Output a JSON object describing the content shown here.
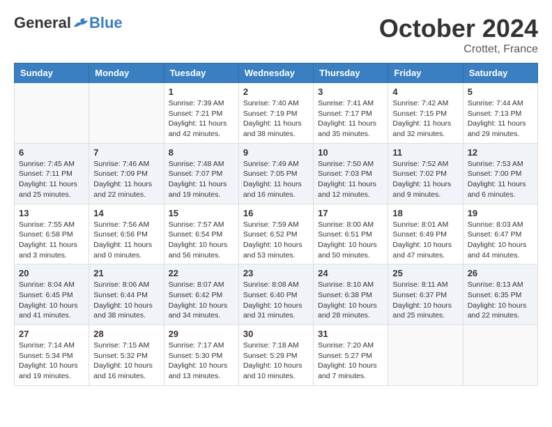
{
  "header": {
    "logo_general": "General",
    "logo_blue": "Blue",
    "month": "October 2024",
    "location": "Crottet, France"
  },
  "weekdays": [
    "Sunday",
    "Monday",
    "Tuesday",
    "Wednesday",
    "Thursday",
    "Friday",
    "Saturday"
  ],
  "weeks": [
    [
      {
        "day": "",
        "sunrise": "",
        "sunset": "",
        "daylight": ""
      },
      {
        "day": "",
        "sunrise": "",
        "sunset": "",
        "daylight": ""
      },
      {
        "day": "1",
        "sunrise": "Sunrise: 7:39 AM",
        "sunset": "Sunset: 7:21 PM",
        "daylight": "Daylight: 11 hours and 42 minutes."
      },
      {
        "day": "2",
        "sunrise": "Sunrise: 7:40 AM",
        "sunset": "Sunset: 7:19 PM",
        "daylight": "Daylight: 11 hours and 38 minutes."
      },
      {
        "day": "3",
        "sunrise": "Sunrise: 7:41 AM",
        "sunset": "Sunset: 7:17 PM",
        "daylight": "Daylight: 11 hours and 35 minutes."
      },
      {
        "day": "4",
        "sunrise": "Sunrise: 7:42 AM",
        "sunset": "Sunset: 7:15 PM",
        "daylight": "Daylight: 11 hours and 32 minutes."
      },
      {
        "day": "5",
        "sunrise": "Sunrise: 7:44 AM",
        "sunset": "Sunset: 7:13 PM",
        "daylight": "Daylight: 11 hours and 29 minutes."
      }
    ],
    [
      {
        "day": "6",
        "sunrise": "Sunrise: 7:45 AM",
        "sunset": "Sunset: 7:11 PM",
        "daylight": "Daylight: 11 hours and 25 minutes."
      },
      {
        "day": "7",
        "sunrise": "Sunrise: 7:46 AM",
        "sunset": "Sunset: 7:09 PM",
        "daylight": "Daylight: 11 hours and 22 minutes."
      },
      {
        "day": "8",
        "sunrise": "Sunrise: 7:48 AM",
        "sunset": "Sunset: 7:07 PM",
        "daylight": "Daylight: 11 hours and 19 minutes."
      },
      {
        "day": "9",
        "sunrise": "Sunrise: 7:49 AM",
        "sunset": "Sunset: 7:05 PM",
        "daylight": "Daylight: 11 hours and 16 minutes."
      },
      {
        "day": "10",
        "sunrise": "Sunrise: 7:50 AM",
        "sunset": "Sunset: 7:03 PM",
        "daylight": "Daylight: 11 hours and 12 minutes."
      },
      {
        "day": "11",
        "sunrise": "Sunrise: 7:52 AM",
        "sunset": "Sunset: 7:02 PM",
        "daylight": "Daylight: 11 hours and 9 minutes."
      },
      {
        "day": "12",
        "sunrise": "Sunrise: 7:53 AM",
        "sunset": "Sunset: 7:00 PM",
        "daylight": "Daylight: 11 hours and 6 minutes."
      }
    ],
    [
      {
        "day": "13",
        "sunrise": "Sunrise: 7:55 AM",
        "sunset": "Sunset: 6:58 PM",
        "daylight": "Daylight: 11 hours and 3 minutes."
      },
      {
        "day": "14",
        "sunrise": "Sunrise: 7:56 AM",
        "sunset": "Sunset: 6:56 PM",
        "daylight": "Daylight: 11 hours and 0 minutes."
      },
      {
        "day": "15",
        "sunrise": "Sunrise: 7:57 AM",
        "sunset": "Sunset: 6:54 PM",
        "daylight": "Daylight: 10 hours and 56 minutes."
      },
      {
        "day": "16",
        "sunrise": "Sunrise: 7:59 AM",
        "sunset": "Sunset: 6:52 PM",
        "daylight": "Daylight: 10 hours and 53 minutes."
      },
      {
        "day": "17",
        "sunrise": "Sunrise: 8:00 AM",
        "sunset": "Sunset: 6:51 PM",
        "daylight": "Daylight: 10 hours and 50 minutes."
      },
      {
        "day": "18",
        "sunrise": "Sunrise: 8:01 AM",
        "sunset": "Sunset: 6:49 PM",
        "daylight": "Daylight: 10 hours and 47 minutes."
      },
      {
        "day": "19",
        "sunrise": "Sunrise: 8:03 AM",
        "sunset": "Sunset: 6:47 PM",
        "daylight": "Daylight: 10 hours and 44 minutes."
      }
    ],
    [
      {
        "day": "20",
        "sunrise": "Sunrise: 8:04 AM",
        "sunset": "Sunset: 6:45 PM",
        "daylight": "Daylight: 10 hours and 41 minutes."
      },
      {
        "day": "21",
        "sunrise": "Sunrise: 8:06 AM",
        "sunset": "Sunset: 6:44 PM",
        "daylight": "Daylight: 10 hours and 38 minutes."
      },
      {
        "day": "22",
        "sunrise": "Sunrise: 8:07 AM",
        "sunset": "Sunset: 6:42 PM",
        "daylight": "Daylight: 10 hours and 34 minutes."
      },
      {
        "day": "23",
        "sunrise": "Sunrise: 8:08 AM",
        "sunset": "Sunset: 6:40 PM",
        "daylight": "Daylight: 10 hours and 31 minutes."
      },
      {
        "day": "24",
        "sunrise": "Sunrise: 8:10 AM",
        "sunset": "Sunset: 6:38 PM",
        "daylight": "Daylight: 10 hours and 28 minutes."
      },
      {
        "day": "25",
        "sunrise": "Sunrise: 8:11 AM",
        "sunset": "Sunset: 6:37 PM",
        "daylight": "Daylight: 10 hours and 25 minutes."
      },
      {
        "day": "26",
        "sunrise": "Sunrise: 8:13 AM",
        "sunset": "Sunset: 6:35 PM",
        "daylight": "Daylight: 10 hours and 22 minutes."
      }
    ],
    [
      {
        "day": "27",
        "sunrise": "Sunrise: 7:14 AM",
        "sunset": "Sunset: 5:34 PM",
        "daylight": "Daylight: 10 hours and 19 minutes."
      },
      {
        "day": "28",
        "sunrise": "Sunrise: 7:15 AM",
        "sunset": "Sunset: 5:32 PM",
        "daylight": "Daylight: 10 hours and 16 minutes."
      },
      {
        "day": "29",
        "sunrise": "Sunrise: 7:17 AM",
        "sunset": "Sunset: 5:30 PM",
        "daylight": "Daylight: 10 hours and 13 minutes."
      },
      {
        "day": "30",
        "sunrise": "Sunrise: 7:18 AM",
        "sunset": "Sunset: 5:29 PM",
        "daylight": "Daylight: 10 hours and 10 minutes."
      },
      {
        "day": "31",
        "sunrise": "Sunrise: 7:20 AM",
        "sunset": "Sunset: 5:27 PM",
        "daylight": "Daylight: 10 hours and 7 minutes."
      },
      {
        "day": "",
        "sunrise": "",
        "sunset": "",
        "daylight": ""
      },
      {
        "day": "",
        "sunrise": "",
        "sunset": "",
        "daylight": ""
      }
    ]
  ]
}
